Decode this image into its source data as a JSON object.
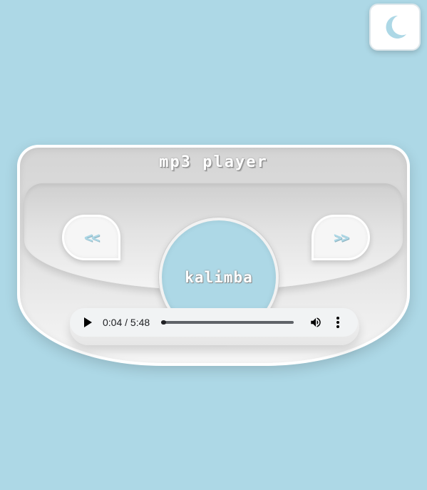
{
  "theme_toggle": {
    "icon": "moon-icon",
    "icon_color": "#add8e6"
  },
  "player": {
    "title": "mp3 player",
    "prev_label": "<<",
    "next_label": ">>",
    "track_name": "Kalimba",
    "disc_color": "#add8e6"
  },
  "audio": {
    "current_time": "0:04",
    "duration": "5:48",
    "time_display": "0:04 / 5:48",
    "progress_fraction": 0.011,
    "play_icon": "play-icon",
    "volume_icon": "volume-icon",
    "more_icon": "more-options-icon"
  },
  "colors": {
    "background": "#add8e6",
    "panel": "#e4e4e4",
    "border": "#ffffff"
  }
}
